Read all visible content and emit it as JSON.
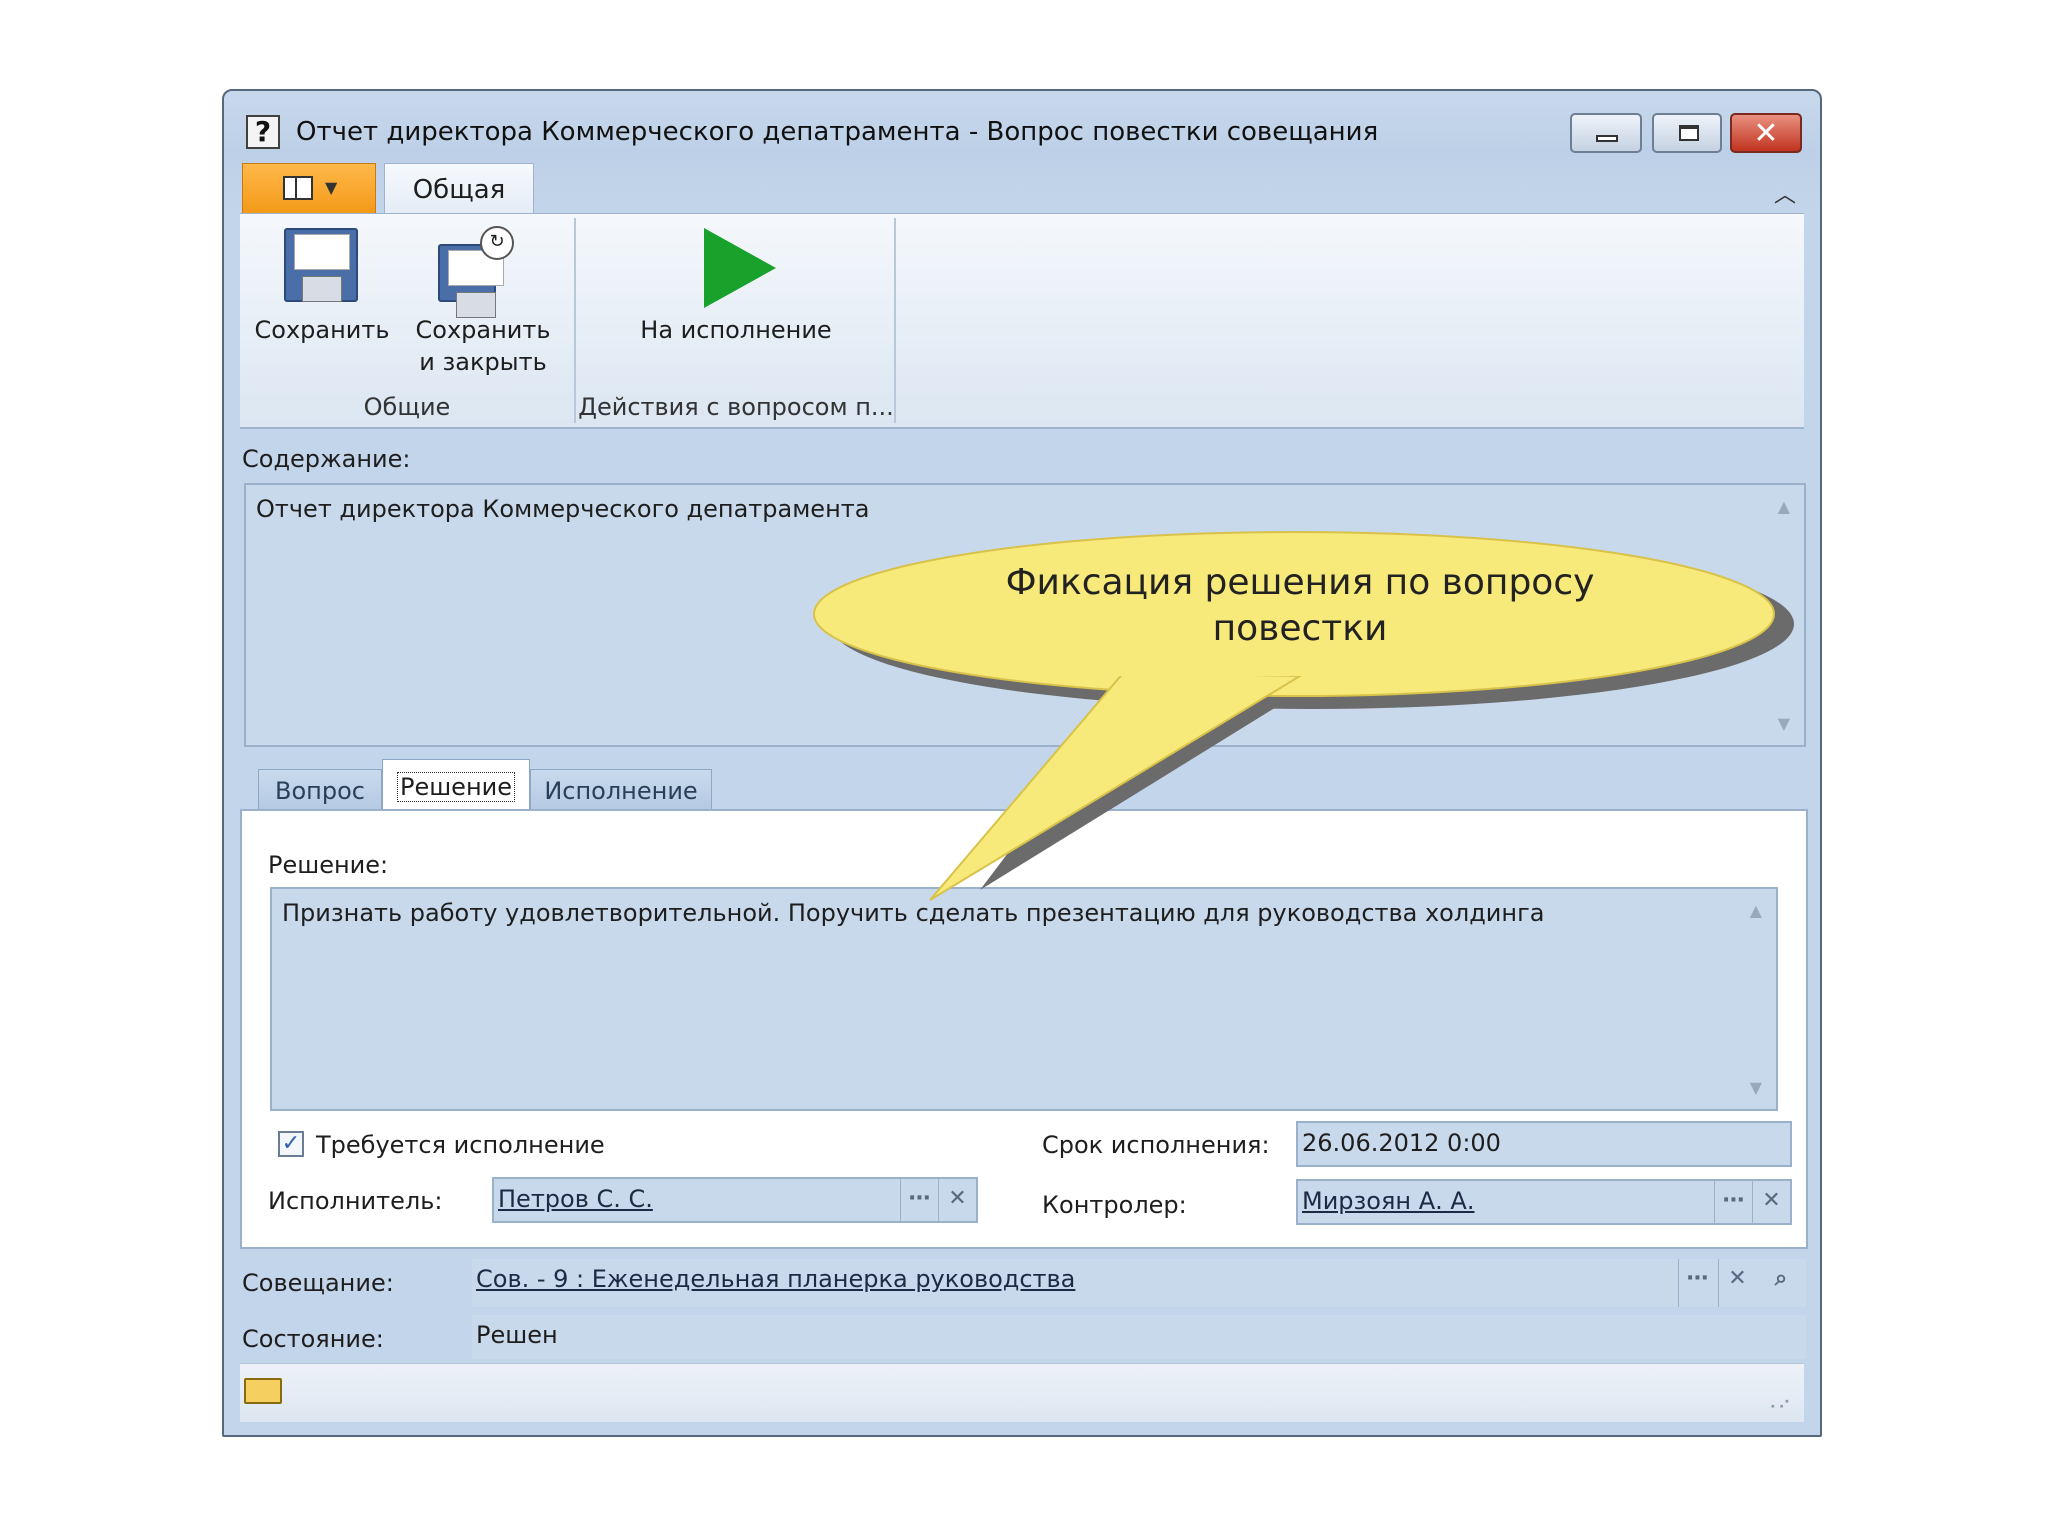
{
  "window": {
    "title": "Отчет директора Коммерческого депатрамента - Вопрос повестки совещания",
    "close_glyph": "✕"
  },
  "ribbon": {
    "tab_general": "Общая",
    "groups": {
      "common": {
        "label": "Общие",
        "save": "Сохранить",
        "save_close_line1": "Сохранить",
        "save_close_line2": "и закрыть"
      },
      "actions": {
        "label": "Действия с вопросом п...",
        "execute": "На исполнение"
      }
    }
  },
  "content": {
    "label": "Содержание:",
    "value": "Отчет директора Коммерческого депатрамента"
  },
  "tabs": [
    "Вопрос",
    "Решение",
    "Исполнение"
  ],
  "decision": {
    "label": "Решение:",
    "value": "Признать работу удовлетворительной. Поручить сделать презентацию для руководства холдинга",
    "requires_execution_label": "Требуется исполнение",
    "requires_execution_checked": true,
    "deadline_label": "Срок исполнения:",
    "deadline_value": "26.06.2012 0:00",
    "executor_label": "Исполнитель:",
    "executor_value": "Петров С. С.",
    "controller_label": "Контролер:",
    "controller_value": "Мирзоян А. А."
  },
  "meeting": {
    "label": "Совещание:",
    "value": "Сов. - 9 : Еженедельная планерка руководства"
  },
  "state": {
    "label": "Состояние:",
    "value": "Решен"
  },
  "callout": {
    "line1": "Фиксация решения по вопросу",
    "line2": "повестки",
    "fill_color": "#f7e97a",
    "shadow_color": "#6b6b6b"
  },
  "icons": [
    "help-icon",
    "minimize-icon",
    "maximize-icon",
    "close-icon",
    "app-menu-icon",
    "collapse-ribbon-icon",
    "save-icon",
    "save-close-icon",
    "play-icon",
    "scroll-up-icon",
    "scroll-down-icon",
    "ellipsis-icon",
    "clear-icon",
    "search-icon",
    "folder-icon",
    "resize-grip-icon"
  ],
  "colors": {
    "accent": "#f39a18",
    "window_bg": "#c3d5ea",
    "field_bg": "#c9d9ec",
    "play_green": "#18a22c"
  }
}
